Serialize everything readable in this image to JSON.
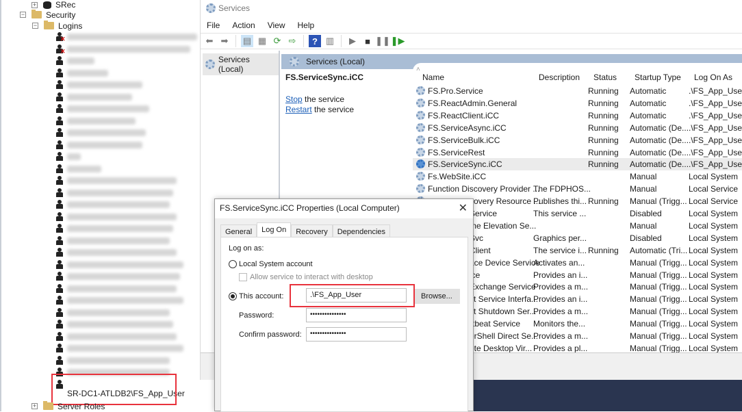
{
  "tree": {
    "srec": "SRec",
    "security": "Security",
    "logins": "Logins",
    "blurred_login_count": 29,
    "disabled_logins": 2,
    "highlighted_login": "SR-DC1-ATLDB2\\FS_App_User",
    "server_roles": "Server Roles"
  },
  "services_window": {
    "title": "Services",
    "menu": [
      "File",
      "Action",
      "View",
      "Help"
    ],
    "left_pane_item": "Services (Local)",
    "header": "Services (Local)",
    "selected_service": "FS.ServiceSync.iCC",
    "stop_link": "Stop",
    "stop_text": " the service",
    "restart_link": "Restart",
    "restart_text": " the service",
    "columns": [
      "Name",
      "Description",
      "Status",
      "Startup Type",
      "Log On As"
    ],
    "rows": [
      {
        "name": "FS.Pro.Service",
        "desc": "",
        "status": "Running",
        "startup": "Automatic",
        "logon": ".\\FS_App_User"
      },
      {
        "name": "FS.ReactAdmin.General",
        "desc": "",
        "status": "Running",
        "startup": "Automatic",
        "logon": ".\\FS_App_User"
      },
      {
        "name": "FS.ReactClient.iCC",
        "desc": "",
        "status": "Running",
        "startup": "Automatic",
        "logon": ".\\FS_App_User"
      },
      {
        "name": "FS.ServiceAsync.iCC",
        "desc": "",
        "status": "Running",
        "startup": "Automatic (De...",
        "logon": ".\\FS_App_User"
      },
      {
        "name": "FS.ServiceBulk.iCC",
        "desc": "",
        "status": "Running",
        "startup": "Automatic (De...",
        "logon": ".\\FS_App_User"
      },
      {
        "name": "FS.ServiceRest",
        "desc": "",
        "status": "Running",
        "startup": "Automatic (De...",
        "logon": ".\\FS_App_User"
      },
      {
        "name": "FS.ServiceSync.iCC",
        "desc": "",
        "status": "Running",
        "startup": "Automatic (De...",
        "logon": ".\\FS_App_User",
        "selected": true
      },
      {
        "name": "Fs.WebSite.iCC",
        "desc": "",
        "status": "",
        "startup": "Manual",
        "logon": "Local System"
      },
      {
        "name": "Function Discovery Provider ...",
        "desc": "The FDPHOS...",
        "status": "",
        "startup": "Manual",
        "logon": "Local Service"
      },
      {
        "name": "covery Resource ...",
        "desc": "Publishes thi...",
        "status": "Running",
        "startup": "Manual (Trigg...",
        "logon": "Local Service"
      },
      {
        "name": "Service",
        "desc": "This service ...",
        "status": "",
        "startup": "Disabled",
        "logon": "Local System"
      },
      {
        "name": "me Elevation Se...",
        "desc": "",
        "status": "",
        "startup": "Manual",
        "logon": "Local System"
      },
      {
        "name": "Svc",
        "desc": "Graphics per...",
        "status": "",
        "startup": "Disabled",
        "logon": "Local System"
      },
      {
        "name": "Client",
        "desc": "The service i...",
        "status": "Running",
        "startup": "Automatic (Tri...",
        "logon": "Local System"
      },
      {
        "name": "ace Device Service",
        "desc": "Activates an...",
        "status": "",
        "startup": "Manual (Trigg...",
        "logon": "Local System"
      },
      {
        "name": "ice",
        "desc": "Provides an i...",
        "status": "",
        "startup": "Manual (Trigg...",
        "logon": "Local System"
      },
      {
        "name": "Exchange Service",
        "desc": "Provides a m...",
        "status": "",
        "startup": "Manual (Trigg...",
        "logon": "Local System"
      },
      {
        "name": "st Service Interfa...",
        "desc": "Provides an i...",
        "status": "",
        "startup": "Manual (Trigg...",
        "logon": "Local System"
      },
      {
        "name": "st Shutdown Ser...",
        "desc": "Provides a m...",
        "status": "",
        "startup": "Manual (Trigg...",
        "logon": "Local System"
      },
      {
        "name": "rtbeat Service",
        "desc": "Monitors the...",
        "status": "",
        "startup": "Manual (Trigg...",
        "logon": "Local System"
      },
      {
        "name": "erShell Direct Se...",
        "desc": "Provides a m...",
        "status": "",
        "startup": "Manual (Trigg...",
        "logon": "Local System"
      },
      {
        "name": "ote Desktop Vir...",
        "desc": "Provides a pl...",
        "status": "",
        "startup": "Manual (Trigg...",
        "logon": "Local System"
      }
    ]
  },
  "dialog": {
    "title": "FS.ServiceSync.iCC Properties (Local Computer)",
    "tabs": [
      "General",
      "Log On",
      "Recovery",
      "Dependencies"
    ],
    "active_tab": "Log On",
    "log_on_as": "Log on as:",
    "local_system": "Local System account",
    "allow_desktop": "Allow service to interact with desktop",
    "this_account": "This account:",
    "account_value": ".\\FS_App_User",
    "browse": "Browse...",
    "password_label": "Password:",
    "password_value": "•••••••••••••••",
    "confirm_label": "Confirm password:",
    "confirm_value": "•••••••••••••••",
    "selected_option": "This account"
  },
  "colors": {
    "highlight": "#e8323c",
    "header": "#a9bdd5",
    "taskbar": "#2a3550",
    "link": "#1c5fb8"
  }
}
